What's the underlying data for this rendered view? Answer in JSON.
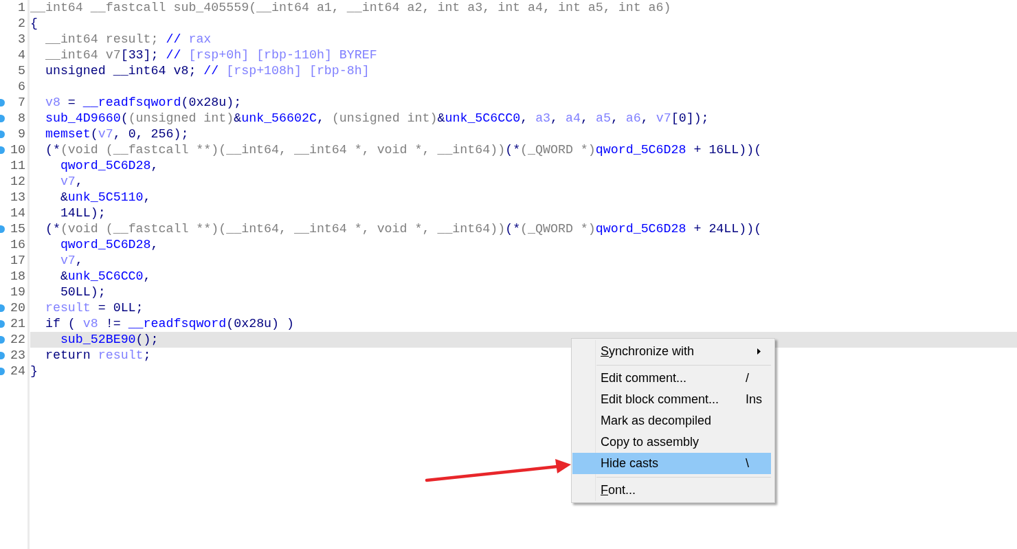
{
  "lines": [
    {
      "number": "1",
      "breakpoint": false,
      "highlighted": false,
      "tokens": [
        {
          "text": "__int64 __fastcall sub_405559(__int64 a1, __int64 a2, int a3, int a4, int a5, int a6)",
          "kind": "cast"
        }
      ]
    },
    {
      "number": "2",
      "breakpoint": false,
      "highlighted": false,
      "tokens": [
        {
          "text": "{",
          "kind": "plain"
        }
      ]
    },
    {
      "number": "3",
      "breakpoint": false,
      "highlighted": false,
      "tokens": [
        {
          "text": "  __int64 result; ",
          "kind": "cast"
        },
        {
          "text": "//",
          "kind": "comment"
        },
        {
          "text": " rax",
          "kind": "variable"
        }
      ]
    },
    {
      "number": "4",
      "breakpoint": false,
      "highlighted": false,
      "tokens": [
        {
          "text": "  __int64 v7",
          "kind": "cast"
        },
        {
          "text": "[33]; ",
          "kind": "plain"
        },
        {
          "text": "//",
          "kind": "comment"
        },
        {
          "text": " [rsp+0h] [rbp-110h] BYREF",
          "kind": "variable"
        }
      ]
    },
    {
      "number": "5",
      "breakpoint": false,
      "highlighted": false,
      "tokens": [
        {
          "text": "  unsigned __int64 v8; ",
          "kind": "plain"
        },
        {
          "text": "//",
          "kind": "comment"
        },
        {
          "text": " [rsp+108h] [rbp-8h]",
          "kind": "variable"
        }
      ]
    },
    {
      "number": "6",
      "breakpoint": false,
      "highlighted": false
    },
    {
      "number": "7",
      "breakpoint": true,
      "highlighted": false,
      "tokens": [
        {
          "text": "  v8",
          "kind": "variable"
        },
        {
          "text": " = ",
          "kind": "plain"
        },
        {
          "text": "__readfsqword",
          "kind": "name"
        },
        {
          "text": "(0x28u);",
          "kind": "plain"
        }
      ]
    },
    {
      "number": "8",
      "breakpoint": true,
      "highlighted": false,
      "tokens": [
        {
          "text": "  sub_4D9660",
          "kind": "name"
        },
        {
          "text": "(",
          "kind": "plain"
        },
        {
          "text": "(unsigned int)",
          "kind": "cast"
        },
        {
          "text": "&",
          "kind": "plain"
        },
        {
          "text": "unk_56602C",
          "kind": "name"
        },
        {
          "text": ", ",
          "kind": "plain"
        },
        {
          "text": "(unsigned int)",
          "kind": "cast"
        },
        {
          "text": "&",
          "kind": "plain"
        },
        {
          "text": "unk_5C6CC0",
          "kind": "name"
        },
        {
          "text": ", ",
          "kind": "plain"
        },
        {
          "text": "a3",
          "kind": "variable"
        },
        {
          "text": ", ",
          "kind": "plain"
        },
        {
          "text": "a4",
          "kind": "variable"
        },
        {
          "text": ", ",
          "kind": "plain"
        },
        {
          "text": "a5",
          "kind": "variable"
        },
        {
          "text": ", ",
          "kind": "plain"
        },
        {
          "text": "a6",
          "kind": "variable"
        },
        {
          "text": ", ",
          "kind": "plain"
        },
        {
          "text": "v7",
          "kind": "variable"
        },
        {
          "text": "[0]);",
          "kind": "plain"
        }
      ]
    },
    {
      "number": "9",
      "breakpoint": true,
      "highlighted": false,
      "tokens": [
        {
          "text": "  memset",
          "kind": "name"
        },
        {
          "text": "(",
          "kind": "plain"
        },
        {
          "text": "v7",
          "kind": "variable"
        },
        {
          "text": ", 0, 256);",
          "kind": "plain"
        }
      ]
    },
    {
      "number": "10",
      "breakpoint": true,
      "highlighted": false,
      "tokens": [
        {
          "text": "  (*",
          "kind": "plain"
        },
        {
          "text": "(void (__fastcall **)(__int64, __int64 *, void *, __int64))",
          "kind": "cast"
        },
        {
          "text": "(*",
          "kind": "plain"
        },
        {
          "text": "(_QWORD *)",
          "kind": "cast"
        },
        {
          "text": "qword_5C6D28",
          "kind": "name"
        },
        {
          "text": " + 16LL))(",
          "kind": "plain"
        }
      ]
    },
    {
      "number": "11",
      "breakpoint": false,
      "highlighted": false,
      "tokens": [
        {
          "text": "    qword_5C6D28",
          "kind": "name"
        },
        {
          "text": ",",
          "kind": "plain"
        }
      ]
    },
    {
      "number": "12",
      "breakpoint": false,
      "highlighted": false,
      "tokens": [
        {
          "text": "    v7",
          "kind": "variable"
        },
        {
          "text": ",",
          "kind": "plain"
        }
      ]
    },
    {
      "number": "13",
      "breakpoint": false,
      "highlighted": false,
      "tokens": [
        {
          "text": "    &",
          "kind": "plain"
        },
        {
          "text": "unk_5C5110",
          "kind": "name"
        },
        {
          "text": ",",
          "kind": "plain"
        }
      ]
    },
    {
      "number": "14",
      "breakpoint": false,
      "highlighted": false,
      "tokens": [
        {
          "text": "    14LL);",
          "kind": "plain"
        }
      ]
    },
    {
      "number": "15",
      "breakpoint": true,
      "highlighted": false,
      "tokens": [
        {
          "text": "  (*",
          "kind": "plain"
        },
        {
          "text": "(void (__fastcall **)(__int64, __int64 *, void *, __int64))",
          "kind": "cast"
        },
        {
          "text": "(*",
          "kind": "plain"
        },
        {
          "text": "(_QWORD *)",
          "kind": "cast"
        },
        {
          "text": "qword_5C6D28",
          "kind": "name"
        },
        {
          "text": " + 24LL))(",
          "kind": "plain"
        }
      ]
    },
    {
      "number": "16",
      "breakpoint": false,
      "highlighted": false,
      "tokens": [
        {
          "text": "    qword_5C6D28",
          "kind": "name"
        },
        {
          "text": ",",
          "kind": "plain"
        }
      ]
    },
    {
      "number": "17",
      "breakpoint": false,
      "highlighted": false,
      "tokens": [
        {
          "text": "    v7",
          "kind": "variable"
        },
        {
          "text": ",",
          "kind": "plain"
        }
      ]
    },
    {
      "number": "18",
      "breakpoint": false,
      "highlighted": false,
      "tokens": [
        {
          "text": "    &",
          "kind": "plain"
        },
        {
          "text": "unk_5C6CC0",
          "kind": "name"
        },
        {
          "text": ",",
          "kind": "plain"
        }
      ]
    },
    {
      "number": "19",
      "breakpoint": false,
      "highlighted": false,
      "tokens": [
        {
          "text": "    50LL);",
          "kind": "plain"
        }
      ]
    },
    {
      "number": "20",
      "breakpoint": true,
      "highlighted": false,
      "tokens": [
        {
          "text": "  result",
          "kind": "variable"
        },
        {
          "text": " = 0LL;",
          "kind": "plain"
        }
      ]
    },
    {
      "number": "21",
      "breakpoint": true,
      "highlighted": false,
      "tokens": [
        {
          "text": "  if ( ",
          "kind": "plain"
        },
        {
          "text": "v8",
          "kind": "variable"
        },
        {
          "text": " != ",
          "kind": "plain"
        },
        {
          "text": "__readfsqword",
          "kind": "name"
        },
        {
          "text": "(0x28u) )",
          "kind": "plain"
        }
      ]
    },
    {
      "number": "22",
      "breakpoint": true,
      "highlighted": true,
      "tokens": [
        {
          "text": "    sub_52BE90",
          "kind": "name"
        },
        {
          "text": "();",
          "kind": "plain"
        }
      ]
    },
    {
      "number": "23",
      "breakpoint": true,
      "highlighted": false,
      "tokens": [
        {
          "text": "  return ",
          "kind": "plain"
        },
        {
          "text": "result",
          "kind": "variable"
        },
        {
          "text": ";",
          "kind": "plain"
        }
      ]
    },
    {
      "number": "24",
      "breakpoint": true,
      "highlighted": false,
      "tokens": [
        {
          "text": "}",
          "kind": "plain"
        }
      ]
    }
  ],
  "context_menu": [
    {
      "kind": "item",
      "label": "Synchronize with",
      "submenu": true,
      "selected": false,
      "underline_first": true
    },
    {
      "kind": "separator"
    },
    {
      "kind": "item",
      "label": "Edit comment...",
      "shortcut": "/",
      "submenu": false,
      "selected": false,
      "underline_first": false
    },
    {
      "kind": "item",
      "label": "Edit block comment...",
      "shortcut": "Ins",
      "submenu": false,
      "selected": false,
      "underline_first": false
    },
    {
      "kind": "item",
      "label": "Mark as decompiled",
      "submenu": false,
      "selected": false,
      "underline_first": false
    },
    {
      "kind": "item",
      "label": "Copy to assembly",
      "submenu": false,
      "selected": false,
      "underline_first": false
    },
    {
      "kind": "item",
      "label": "Hide casts",
      "shortcut": "\\",
      "submenu": false,
      "selected": true,
      "underline_first": false
    },
    {
      "kind": "separator"
    },
    {
      "kind": "item",
      "label": "Font...",
      "submenu": false,
      "selected": false,
      "underline_first": true
    }
  ]
}
